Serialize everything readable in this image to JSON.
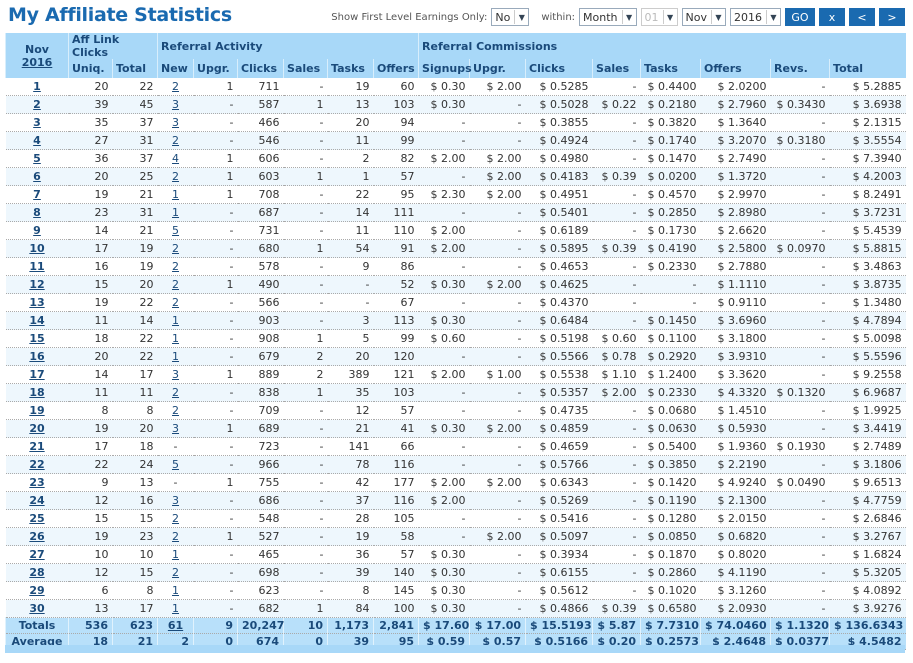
{
  "title": "My Affiliate Statistics",
  "controls": {
    "first_level_label": "Show First Level Earnings Only:",
    "first_level_value": "No",
    "within_label": "within:",
    "period": "Month",
    "day": "01",
    "month": "Nov",
    "year": "2016",
    "go": "GO",
    "clear": "x",
    "prev": "<",
    "next": ">"
  },
  "colors": {
    "accent": "#1a6ab0",
    "header_bg": "#a8d8f8"
  },
  "table": {
    "month_label": "Nov",
    "year_link": "2016",
    "groups": [
      "Aff Link Clicks",
      "Referral Activity",
      "Referral Commissions"
    ],
    "columns": [
      "Uniq.",
      "Total",
      "New",
      "Upgr.",
      "Clicks",
      "Sales",
      "Tasks",
      "Offers",
      "Signups",
      "Upgr.",
      "Clicks",
      "Sales",
      "Tasks",
      "Offers",
      "Revs.",
      "Total"
    ],
    "rows": [
      [
        "1",
        "20",
        "22",
        "2",
        "1",
        "711",
        "-",
        "19",
        "60",
        "$ 0.30",
        "$ 2.00",
        "$ 0.5285",
        "-",
        "$ 0.4400",
        "$ 2.0200",
        "-",
        "$ 5.2885"
      ],
      [
        "2",
        "39",
        "45",
        "3",
        "-",
        "587",
        "1",
        "13",
        "103",
        "$ 0.30",
        "-",
        "$ 0.5028",
        "$ 0.22",
        "$ 0.2180",
        "$ 2.7960",
        "$ 0.3430",
        "$ 3.6938"
      ],
      [
        "3",
        "35",
        "37",
        "3",
        "-",
        "466",
        "-",
        "20",
        "94",
        "-",
        "-",
        "$ 0.3855",
        "-",
        "$ 0.3820",
        "$ 1.3640",
        "-",
        "$ 2.1315"
      ],
      [
        "4",
        "27",
        "31",
        "2",
        "-",
        "546",
        "-",
        "11",
        "99",
        "-",
        "-",
        "$ 0.4924",
        "-",
        "$ 0.1740",
        "$ 3.2070",
        "$ 0.3180",
        "$ 3.5554"
      ],
      [
        "5",
        "36",
        "37",
        "4",
        "1",
        "606",
        "-",
        "2",
        "82",
        "$ 2.00",
        "$ 2.00",
        "$ 0.4980",
        "-",
        "$ 0.1470",
        "$ 2.7490",
        "-",
        "$ 7.3940"
      ],
      [
        "6",
        "20",
        "25",
        "2",
        "1",
        "603",
        "1",
        "1",
        "57",
        "-",
        "$ 2.00",
        "$ 0.4183",
        "$ 0.39",
        "$ 0.0200",
        "$ 1.3720",
        "-",
        "$ 4.2003"
      ],
      [
        "7",
        "19",
        "21",
        "1",
        "1",
        "708",
        "-",
        "22",
        "95",
        "$ 2.30",
        "$ 2.00",
        "$ 0.4951",
        "-",
        "$ 0.4570",
        "$ 2.9970",
        "-",
        "$ 8.2491"
      ],
      [
        "8",
        "23",
        "31",
        "1",
        "-",
        "687",
        "-",
        "14",
        "111",
        "-",
        "-",
        "$ 0.5401",
        "-",
        "$ 0.2850",
        "$ 2.8980",
        "-",
        "$ 3.7231"
      ],
      [
        "9",
        "14",
        "21",
        "5",
        "-",
        "731",
        "-",
        "11",
        "110",
        "$ 2.00",
        "-",
        "$ 0.6189",
        "-",
        "$ 0.1730",
        "$ 2.6620",
        "-",
        "$ 5.4539"
      ],
      [
        "10",
        "17",
        "19",
        "2",
        "-",
        "680",
        "1",
        "54",
        "91",
        "$ 2.00",
        "-",
        "$ 0.5895",
        "$ 0.39",
        "$ 0.4190",
        "$ 2.5800",
        "$ 0.0970",
        "$ 5.8815"
      ],
      [
        "11",
        "16",
        "19",
        "2",
        "-",
        "578",
        "-",
        "9",
        "86",
        "-",
        "-",
        "$ 0.4653",
        "-",
        "$ 0.2330",
        "$ 2.7880",
        "-",
        "$ 3.4863"
      ],
      [
        "12",
        "15",
        "20",
        "2",
        "1",
        "490",
        "-",
        "-",
        "52",
        "$ 0.30",
        "$ 2.00",
        "$ 0.4625",
        "-",
        "-",
        "$ 1.1110",
        "-",
        "$ 3.8735"
      ],
      [
        "13",
        "19",
        "22",
        "2",
        "-",
        "566",
        "-",
        "-",
        "67",
        "-",
        "-",
        "$ 0.4370",
        "-",
        "-",
        "$ 0.9110",
        "-",
        "$ 1.3480"
      ],
      [
        "14",
        "11",
        "14",
        "1",
        "-",
        "903",
        "-",
        "3",
        "113",
        "$ 0.30",
        "-",
        "$ 0.6484",
        "-",
        "$ 0.1450",
        "$ 3.6960",
        "-",
        "$ 4.7894"
      ],
      [
        "15",
        "18",
        "22",
        "1",
        "-",
        "908",
        "1",
        "5",
        "99",
        "$ 0.60",
        "-",
        "$ 0.5198",
        "$ 0.60",
        "$ 0.1100",
        "$ 3.1800",
        "-",
        "$ 5.0098"
      ],
      [
        "16",
        "20",
        "22",
        "1",
        "-",
        "679",
        "2",
        "20",
        "120",
        "-",
        "-",
        "$ 0.5566",
        "$ 0.78",
        "$ 0.2920",
        "$ 3.9310",
        "-",
        "$ 5.5596"
      ],
      [
        "17",
        "14",
        "17",
        "3",
        "1",
        "889",
        "2",
        "389",
        "121",
        "$ 2.00",
        "$ 1.00",
        "$ 0.5538",
        "$ 1.10",
        "$ 1.2400",
        "$ 3.3620",
        "-",
        "$ 9.2558"
      ],
      [
        "18",
        "11",
        "11",
        "2",
        "-",
        "838",
        "1",
        "35",
        "103",
        "-",
        "-",
        "$ 0.5357",
        "$ 2.00",
        "$ 0.2330",
        "$ 4.3320",
        "$ 0.1320",
        "$ 6.9687"
      ],
      [
        "19",
        "8",
        "8",
        "2",
        "-",
        "709",
        "-",
        "12",
        "57",
        "-",
        "-",
        "$ 0.4735",
        "-",
        "$ 0.0680",
        "$ 1.4510",
        "-",
        "$ 1.9925"
      ],
      [
        "20",
        "19",
        "20",
        "3",
        "1",
        "689",
        "-",
        "21",
        "41",
        "$ 0.30",
        "$ 2.00",
        "$ 0.4859",
        "-",
        "$ 0.0630",
        "$ 0.5930",
        "-",
        "$ 3.4419"
      ],
      [
        "21",
        "17",
        "18",
        "-",
        "-",
        "723",
        "-",
        "141",
        "66",
        "-",
        "-",
        "$ 0.4659",
        "-",
        "$ 0.5400",
        "$ 1.9360",
        "$ 0.1930",
        "$ 2.7489"
      ],
      [
        "22",
        "22",
        "24",
        "5",
        "-",
        "966",
        "-",
        "78",
        "116",
        "-",
        "-",
        "$ 0.5766",
        "-",
        "$ 0.3850",
        "$ 2.2190",
        "-",
        "$ 3.1806"
      ],
      [
        "23",
        "9",
        "13",
        "-",
        "1",
        "755",
        "-",
        "42",
        "177",
        "$ 2.00",
        "$ 2.00",
        "$ 0.6343",
        "-",
        "$ 0.1420",
        "$ 4.9240",
        "$ 0.0490",
        "$ 9.6513"
      ],
      [
        "24",
        "12",
        "16",
        "3",
        "-",
        "686",
        "-",
        "37",
        "116",
        "$ 2.00",
        "-",
        "$ 0.5269",
        "-",
        "$ 0.1190",
        "$ 2.1300",
        "-",
        "$ 4.7759"
      ],
      [
        "25",
        "15",
        "15",
        "2",
        "-",
        "548",
        "-",
        "28",
        "105",
        "-",
        "-",
        "$ 0.5416",
        "-",
        "$ 0.1280",
        "$ 2.0150",
        "-",
        "$ 2.6846"
      ],
      [
        "26",
        "19",
        "23",
        "2",
        "1",
        "527",
        "-",
        "19",
        "58",
        "-",
        "$ 2.00",
        "$ 0.5097",
        "-",
        "$ 0.0850",
        "$ 0.6820",
        "-",
        "$ 3.2767"
      ],
      [
        "27",
        "10",
        "10",
        "1",
        "-",
        "465",
        "-",
        "36",
        "57",
        "$ 0.30",
        "-",
        "$ 0.3934",
        "-",
        "$ 0.1870",
        "$ 0.8020",
        "-",
        "$ 1.6824"
      ],
      [
        "28",
        "12",
        "15",
        "2",
        "-",
        "698",
        "-",
        "39",
        "140",
        "$ 0.30",
        "-",
        "$ 0.6155",
        "-",
        "$ 0.2860",
        "$ 4.1190",
        "-",
        "$ 5.3205"
      ],
      [
        "29",
        "6",
        "8",
        "1",
        "-",
        "623",
        "-",
        "8",
        "145",
        "$ 0.30",
        "-",
        "$ 0.5612",
        "-",
        "$ 0.1020",
        "$ 3.1260",
        "-",
        "$ 4.0892"
      ],
      [
        "30",
        "13",
        "17",
        "1",
        "-",
        "682",
        "1",
        "84",
        "100",
        "$ 0.30",
        "-",
        "$ 0.4866",
        "$ 0.39",
        "$ 0.6580",
        "$ 2.0930",
        "-",
        "$ 3.9276"
      ]
    ],
    "totals": [
      "Totals",
      "536",
      "623",
      "61",
      "9",
      "20,247",
      "10",
      "1,173",
      "2,841",
      "$ 17.60",
      "$ 17.00",
      "$ 15.5193",
      "$ 5.87",
      "$ 7.7310",
      "$ 74.0460",
      "$ 1.1320",
      "$ 136.6343"
    ],
    "average": [
      "Average",
      "18",
      "21",
      "2",
      "0",
      "674",
      "0",
      "39",
      "95",
      "$ 0.59",
      "$ 0.57",
      "$ 0.5166",
      "$ 0.20",
      "$ 0.2573",
      "$ 2.4648",
      "$ 0.0377",
      "$ 4.5482"
    ]
  }
}
